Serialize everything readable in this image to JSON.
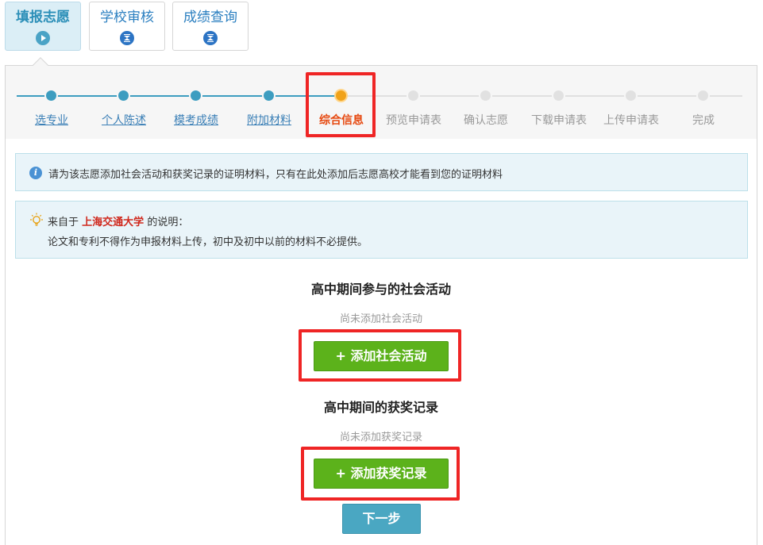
{
  "tabs": [
    {
      "label": "填报志愿",
      "icon": "play-circle-icon"
    },
    {
      "label": "学校审核",
      "icon": "hourglass-icon"
    },
    {
      "label": "成绩查询",
      "icon": "hourglass-icon"
    }
  ],
  "steps": [
    {
      "label": "选专业",
      "status": "done"
    },
    {
      "label": "个人陈述",
      "status": "done"
    },
    {
      "label": "模考成绩",
      "status": "done"
    },
    {
      "label": "附加材料",
      "status": "done"
    },
    {
      "label": "综合信息",
      "status": "current"
    },
    {
      "label": "预览申请表",
      "status": "pending"
    },
    {
      "label": "确认志愿",
      "status": "pending"
    },
    {
      "label": "下载申请表",
      "status": "pending"
    },
    {
      "label": "上传申请表",
      "status": "pending"
    },
    {
      "label": "完成",
      "status": "pending"
    }
  ],
  "notice": {
    "text": "请为该志愿添加社会活动和获奖记录的证明材料，只有在此处添加后志愿高校才能看到您的证明材料"
  },
  "school_note": {
    "prefix": "来自于",
    "school": "上海交通大学",
    "suffix": "的说明：",
    "body": "论文和专利不得作为申报材料上传，初中及初中以前的材料不必提供。"
  },
  "activities": {
    "title": "高中期间参与的社会活动",
    "empty": "尚未添加社会活动",
    "button": "+ 添加社会活动"
  },
  "awards": {
    "title": "高中期间的获奖记录",
    "empty": "尚未添加获奖记录",
    "button": "+ 添加获奖记录"
  },
  "next_button": "下一步",
  "colors": {
    "done": "#3d9dc0",
    "current": "#f0a219",
    "current_label": "#e6480f",
    "green_button": "#5cb21b",
    "next_button": "#4aa7c2",
    "highlight": "#ef2525"
  }
}
